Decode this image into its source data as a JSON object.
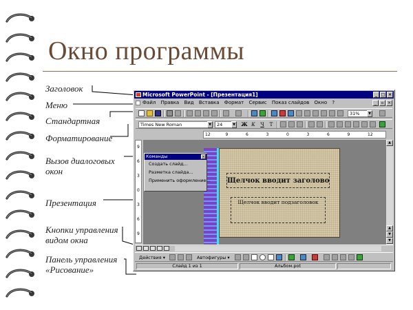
{
  "title": "Окно программы",
  "callouts": [
    {
      "text": "Заголовок"
    },
    {
      "text": "Меню"
    },
    {
      "text": "Стандартная"
    },
    {
      "text": "Форматирование"
    },
    {
      "text": "Вызов диалоговых\nокон"
    },
    {
      "text": "Презентация"
    },
    {
      "text": "Кнопки управления\nвидом окна"
    },
    {
      "text": "Панель управления\n«Рисование»"
    }
  ],
  "window": {
    "title": "Microsoft PowerPoint - [Презентация1]",
    "controls": [
      "_",
      "□",
      "×"
    ],
    "doc_controls": [
      "_",
      "▫",
      "×"
    ],
    "menu": [
      "Файл",
      "Правка",
      "Вид",
      "Вставка",
      "Формат",
      "Сервис",
      "Показ слайдов",
      "Окно",
      "?"
    ],
    "zoom": "31%",
    "font_name": "Times New Roman",
    "font_size": "24",
    "format_buttons": [
      "Ж",
      "К",
      "Ч",
      "Т"
    ],
    "ruler_h": [
      "12",
      "9",
      "6",
      "3",
      "0",
      "3",
      "6",
      "9",
      "12"
    ],
    "ruler_v": [
      "9",
      "6",
      "3",
      "0",
      "3",
      "6",
      "9"
    ],
    "popup": {
      "title": "Команды",
      "items": [
        "Создать слайд...",
        "Разметка слайда...",
        "Применить оформление..."
      ]
    },
    "slide": {
      "title_placeholder": "Щелчок вводит заголовок",
      "subtitle_placeholder": "Щелчок вводит подзаголовок"
    },
    "draw": {
      "actions": "Действия ▾",
      "autoshapes": "Автофигуры ▾"
    },
    "status": {
      "slide": "Слайд 1 из 1",
      "template": "Альбом.pot"
    }
  },
  "colors": {
    "title_brown": "#6b4a35",
    "titlebar_blue": "#000080"
  }
}
